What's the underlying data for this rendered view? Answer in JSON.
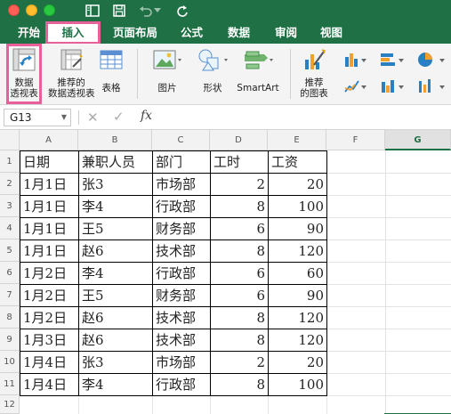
{
  "titlebar": {
    "window_controls": [
      "close",
      "minimize",
      "maximize"
    ],
    "quick_access_icons": [
      "sidebar-icon",
      "save-icon",
      "undo-icon",
      "undo-dropdown-icon",
      "redo-icon"
    ]
  },
  "tabs": [
    {
      "label": "开始",
      "active": false
    },
    {
      "label": "插入",
      "active": true
    },
    {
      "label": "页面布局",
      "active": false
    },
    {
      "label": "公式",
      "active": false
    },
    {
      "label": "数据",
      "active": false
    },
    {
      "label": "审阅",
      "active": false
    },
    {
      "label": "视图",
      "active": false
    }
  ],
  "ribbon": {
    "pivot_label_1": "数据",
    "pivot_label_2": "透视表",
    "recommended_pivot_label_1": "推荐的",
    "recommended_pivot_label_2": "数据透视表",
    "table_label": "表格",
    "picture_label": "图片",
    "shapes_label": "形状",
    "smartart_label": "SmartArt",
    "recommended_chart_label_1": "推荐",
    "recommended_chart_label_2": "的图表"
  },
  "formula_bar": {
    "name_box": "G13",
    "cancel_symbol": "✕",
    "enter_symbol": "✓",
    "fx_symbol": "fx",
    "content": ""
  },
  "sheet": {
    "columns": [
      "A",
      "B",
      "C",
      "D",
      "E",
      "F",
      "G"
    ],
    "selected_column": "G",
    "rows": [
      "1",
      "2",
      "3",
      "4",
      "5",
      "6",
      "7",
      "8",
      "9",
      "10",
      "11",
      "12"
    ],
    "headers": [
      "日期",
      "兼职人员",
      "部门",
      "工时",
      "工资"
    ],
    "data": [
      [
        "1月1日",
        "张3",
        "市场部",
        "2",
        "20"
      ],
      [
        "1月1日",
        "李4",
        "行政部",
        "8",
        "100"
      ],
      [
        "1月1日",
        "王5",
        "财务部",
        "6",
        "90"
      ],
      [
        "1月1日",
        "赵6",
        "技术部",
        "8",
        "120"
      ],
      [
        "1月2日",
        "李4",
        "行政部",
        "6",
        "60"
      ],
      [
        "1月2日",
        "王5",
        "财务部",
        "6",
        "90"
      ],
      [
        "1月2日",
        "赵6",
        "技术部",
        "8",
        "120"
      ],
      [
        "1月3日",
        "赵6",
        "技术部",
        "8",
        "120"
      ],
      [
        "1月4日",
        "张3",
        "市场部",
        "2",
        "20"
      ],
      [
        "1月4日",
        "李4",
        "行政部",
        "8",
        "100"
      ]
    ]
  },
  "colors": {
    "excel_green": "#1f7145",
    "highlight_pink": "#e8609a"
  }
}
